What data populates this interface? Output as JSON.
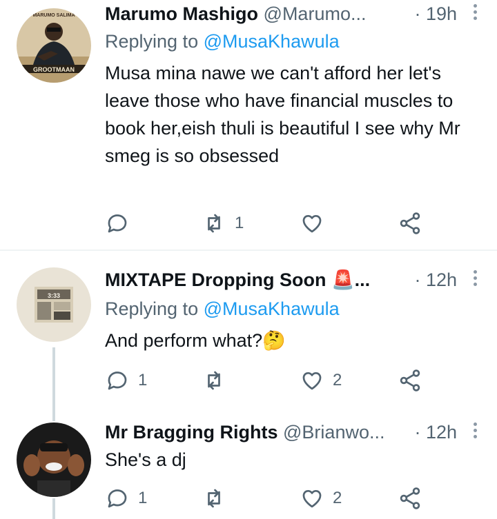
{
  "tweets": [
    {
      "name": "Marumo Mashigo",
      "handle": "@Marumo...",
      "time": "· 19h",
      "replying_label": "Replying to",
      "replying_to": "@MusaKhawula",
      "text": "Musa mina nawe we can't afford her let's leave those who have financial muscles to book her,eish thuli is beautiful  I see why Mr smeg is so obsessed",
      "replies": "",
      "retweets": "1",
      "likes": "",
      "avatar_text_top": "MARUMO SALIMA",
      "avatar_text_bottom": "GROOTMAAN"
    },
    {
      "name": "MIXTAPE Dropping Soon 🚨...",
      "handle": "",
      "time": "· 12h",
      "replying_label": "Replying to",
      "replying_to": "@MusaKhawula",
      "text": "And perform what?🤔",
      "replies": "1",
      "retweets": "",
      "likes": "2"
    },
    {
      "name": "Mr Bragging Rights",
      "handle": "@Brianwo...",
      "time": "· 12h",
      "text": "She's a dj",
      "replies": "1",
      "retweets": "",
      "likes": "2"
    }
  ],
  "colors": {
    "accent": "#1d9bf0",
    "muted": "#536471",
    "text": "#0f1419",
    "line": "#cfd9de"
  },
  "icons": [
    "reply-icon",
    "retweet-icon",
    "like-icon",
    "share-icon",
    "more-icon"
  ]
}
